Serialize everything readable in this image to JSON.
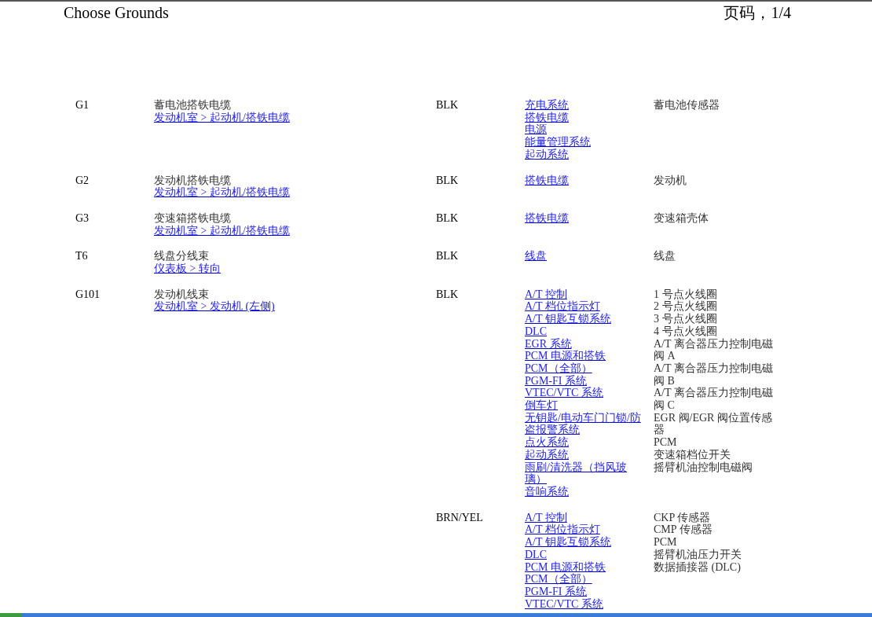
{
  "header": {
    "title": "Choose Grounds",
    "page_number": "页码，1/4"
  },
  "rows": [
    {
      "code": "G1",
      "name": "蓄电池搭铁电缆",
      "location": "发动机室 > 起动机/搭铁电缆",
      "wire_color": "BLK",
      "systems": [
        "充电系统",
        "搭铁电缆",
        "电源",
        "能量管理系统",
        "起动系统"
      ],
      "components": [
        "蓄电池传感器"
      ]
    },
    {
      "code": "G2",
      "name": "发动机搭铁电缆",
      "location": "发动机室 > 起动机/搭铁电缆",
      "wire_color": "BLK",
      "systems": [
        "搭铁电缆"
      ],
      "components": [
        "发动机"
      ]
    },
    {
      "code": "G3",
      "name": "变速箱搭铁电缆",
      "location": "发动机室 > 起动机/搭铁电缆",
      "wire_color": "BLK",
      "systems": [
        "搭铁电缆"
      ],
      "components": [
        "变速箱壳体"
      ]
    },
    {
      "code": "T6",
      "name": "线盘分线束",
      "location": "仪表板 > 转向",
      "wire_color": "BLK",
      "systems": [
        "线盘"
      ],
      "components": [
        "线盘"
      ]
    },
    {
      "code": "G101",
      "name": "发动机线束",
      "location": "发动机室 > 发动机 (左侧)",
      "wire_color": "BLK",
      "systems": [
        "A/T 控制",
        "A/T 档位指示灯",
        "A/T 钥匙互锁系统",
        "DLC",
        "EGR 系统",
        "PCM 电源和搭铁",
        "PCM（全部）",
        "PGM-FI 系统",
        "VTEC/VTC 系统",
        "倒车灯",
        "无钥匙/电动车门门锁/防盗报警系统",
        "点火系统",
        "起动系统",
        "雨刷/清洗器（挡风玻璃）",
        "音响系统"
      ],
      "components": [
        "1 号点火线圈",
        "2 号点火线圈",
        "3 号点火线圈",
        "4 号点火线圈",
        "A/T 离合器压力控制电磁阀 A",
        "A/T 离合器压力控制电磁阀 B",
        "A/T 离合器压力控制电磁阀 C",
        "EGR 阀/EGR 阀位置传感器",
        "PCM",
        "变速箱档位开关",
        "摇臂机油控制电磁阀"
      ]
    },
    {
      "wire_color": "BRN/YEL",
      "systems": [
        "A/T 控制",
        "A/T 档位指示灯",
        "A/T 钥匙互锁系统",
        "DLC",
        "PCM 电源和搭铁",
        "PCM（全部）",
        "PGM-FI 系统",
        "VTEC/VTC 系统"
      ],
      "components": [
        "CKP 传感器",
        "CMP 传感器",
        "PCM",
        "摇臂机油压力开关",
        "数据插接器 (DLC)"
      ]
    }
  ]
}
